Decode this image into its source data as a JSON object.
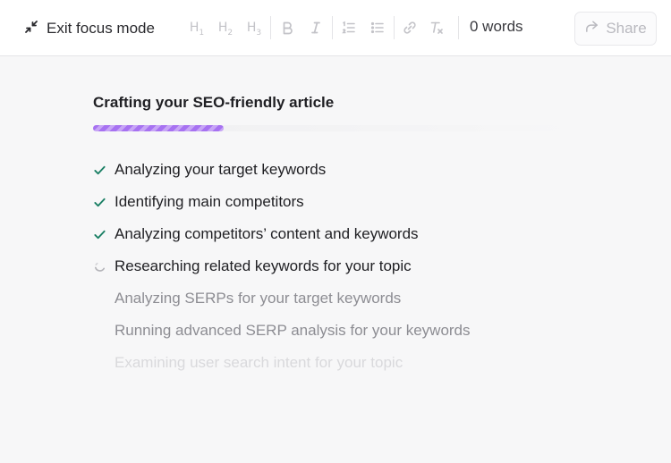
{
  "toolbar": {
    "exit_label": "Exit focus mode",
    "h1_label": "H",
    "h1_sub": "1",
    "h2_label": "H",
    "h2_sub": "2",
    "h3_label": "H",
    "h3_sub": "3",
    "words_label": "0 words",
    "share_label": "Share"
  },
  "main": {
    "title": "Crafting your SEO-friendly article",
    "progress_fraction": 0.27,
    "accent_color": "#a772f1",
    "check_color": "#1a7f64",
    "steps": [
      {
        "label": "Analyzing your target keywords",
        "status": "done"
      },
      {
        "label": "Identifying main competitors",
        "status": "done"
      },
      {
        "label": "Analyzing competitors’ content and keywords",
        "status": "done"
      },
      {
        "label": "Researching related keywords for your topic",
        "status": "in-progress"
      },
      {
        "label": "Analyzing SERPs for your target keywords",
        "status": "pending"
      },
      {
        "label": "Running advanced SERP analysis for your keywords",
        "status": "pending"
      },
      {
        "label": "Examining user search intent for your topic",
        "status": "pending"
      }
    ]
  }
}
